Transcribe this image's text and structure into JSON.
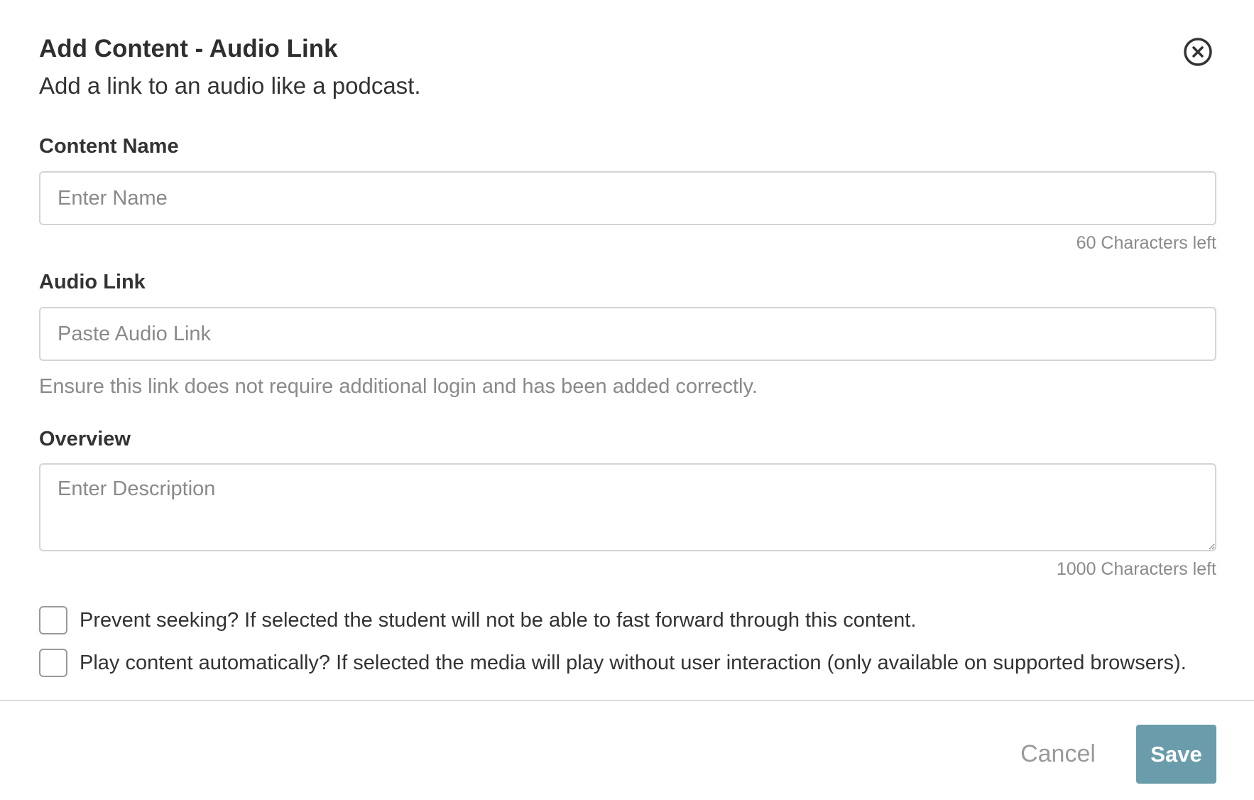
{
  "dialog": {
    "title": "Add Content - Audio Link",
    "subtitle": "Add a link to an audio like a podcast."
  },
  "icons": {
    "close": "close-circle-icon"
  },
  "content_name": {
    "label": "Content Name",
    "placeholder": "Enter Name",
    "value": "",
    "char_count": "60 Characters left"
  },
  "audio_link": {
    "label": "Audio Link",
    "placeholder": "Paste Audio Link",
    "value": "",
    "help": "Ensure this link does not require additional login and has been added correctly."
  },
  "overview": {
    "label": "Overview",
    "placeholder": "Enter Description",
    "value": "",
    "char_count": "1000 Characters left"
  },
  "options": [
    {
      "label": "Prevent seeking? If selected the student will not be able to fast forward through this content.",
      "checked": false
    },
    {
      "label": "Play content automatically? If selected the media will play without user interaction (only available on supported browsers).",
      "checked": false
    }
  ],
  "footer": {
    "cancel_label": "Cancel",
    "save_label": "Save"
  },
  "colors": {
    "save_button": "#6a9cab",
    "muted_text": "#8a8a8a",
    "border": "#d4d4d4"
  }
}
